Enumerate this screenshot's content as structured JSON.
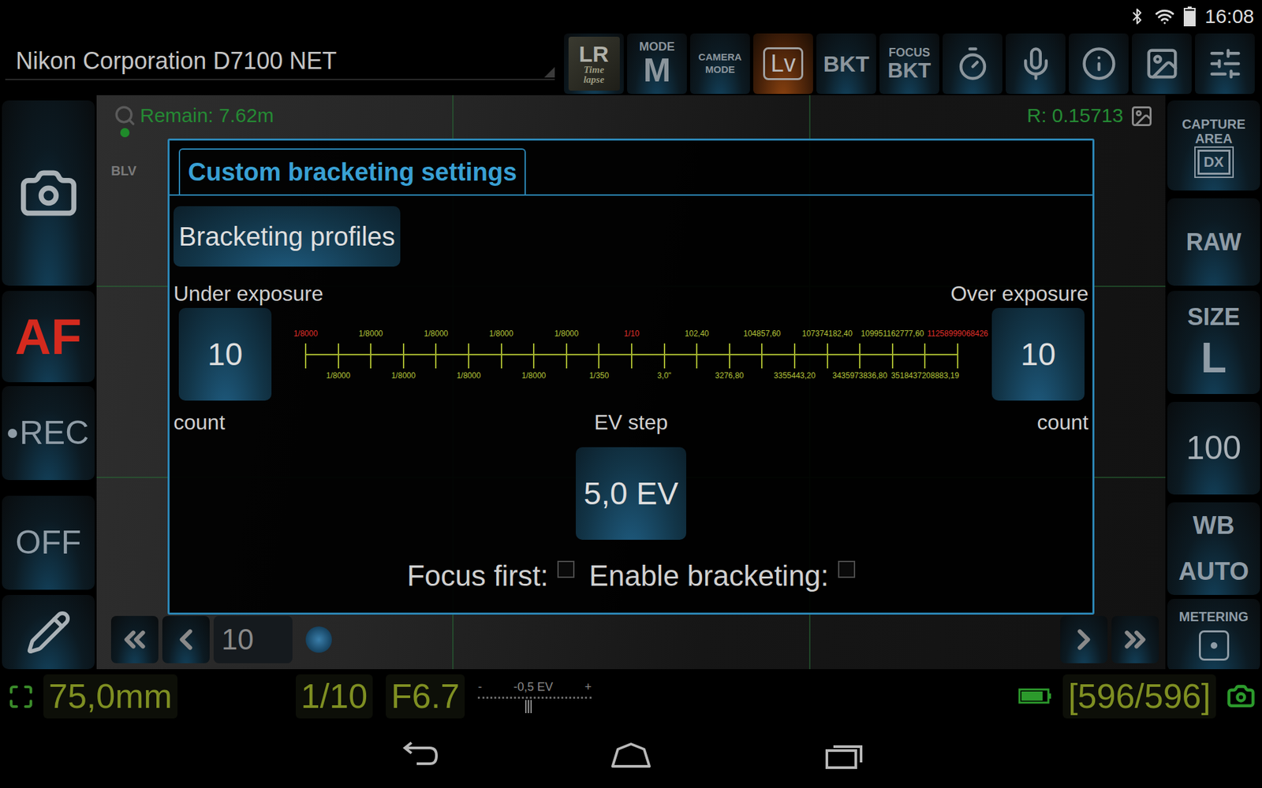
{
  "status_bar": {
    "time": "16:08",
    "battery_level": 0.9
  },
  "app_bar": {
    "title": "Nikon Corporation D7100 NET",
    "toolbar": [
      {
        "kind": "logo",
        "lines": [
          "LR",
          "Time",
          "lapse"
        ],
        "selected": false
      },
      {
        "kind": "stack",
        "small": "MODE",
        "big": "M",
        "selected": false
      },
      {
        "kind": "caption",
        "lines": [
          "CAMERA",
          "MODE"
        ],
        "selected": false
      },
      {
        "kind": "boxed",
        "big": "Lv",
        "selected": true
      },
      {
        "kind": "big",
        "big": "BKT",
        "selected": false
      },
      {
        "kind": "stack",
        "small": "FOCUS",
        "big": "BKT",
        "selected": false
      },
      {
        "kind": "icon",
        "selected": false
      },
      {
        "kind": "icon",
        "selected": false
      },
      {
        "kind": "icon",
        "selected": false
      },
      {
        "kind": "icon",
        "selected": false
      },
      {
        "kind": "icon",
        "selected": false
      }
    ]
  },
  "left_panel": [
    {
      "kind": "icon"
    },
    {
      "kind": "strong",
      "label": "AF",
      "color": "#d42a1e"
    },
    {
      "kind": "rec",
      "label": "REC",
      "color": "#8f9ca6"
    },
    {
      "kind": "text",
      "label": "OFF",
      "color": "#8f9ca6"
    },
    {
      "kind": "icon"
    }
  ],
  "right_panel": [
    {
      "kind": "badge",
      "lines": [
        "CAPTURE",
        "AREA"
      ],
      "badge": "DX"
    },
    {
      "kind": "text",
      "label": "RAW"
    },
    {
      "kind": "stack",
      "small": "SIZE",
      "big": "L"
    },
    {
      "kind": "value",
      "label": "100"
    },
    {
      "kind": "lines",
      "lines": [
        "WB",
        "AUTO"
      ]
    },
    {
      "kind": "caption",
      "lines": [
        "METERING"
      ]
    }
  ],
  "live_view": {
    "remain": "Remain: 7.62m",
    "mode": "BLV",
    "ratio": "R: 0.15713",
    "frame_field": "10"
  },
  "dialog": {
    "tab": "Custom bracketing settings",
    "profiles_button": "Bracketing profiles",
    "under": {
      "label": "Under exposure",
      "count": "10",
      "caption": "count"
    },
    "over": {
      "label": "Over exposure",
      "count": "10",
      "caption": "count"
    },
    "ev_step": {
      "label": "EV step",
      "value": "5,0 EV"
    },
    "scale": {
      "top": [
        {
          "text": "1/8000",
          "color": "#e0302a"
        },
        {
          "text": "1/8000",
          "color": "#b4c43a"
        },
        {
          "text": "1/8000",
          "color": "#b4c43a"
        },
        {
          "text": "1/8000",
          "color": "#b4c43a"
        },
        {
          "text": "1/8000",
          "color": "#b4c43a"
        },
        {
          "text": "1/10",
          "color": "#e0302a"
        },
        {
          "text": "102,40",
          "color": "#b4c43a"
        },
        {
          "text": "104857,60",
          "color": "#b4c43a"
        },
        {
          "text": "107374182,40",
          "color": "#b4c43a"
        },
        {
          "text": "109951162777,60",
          "color": "#b4c43a"
        },
        {
          "text": "11258999068426",
          "color": "#e0302a"
        }
      ],
      "bottom": [
        {
          "text": "1/8000",
          "color": "#b4c43a"
        },
        {
          "text": "1/8000",
          "color": "#b4c43a"
        },
        {
          "text": "1/8000",
          "color": "#b4c43a"
        },
        {
          "text": "1/8000",
          "color": "#b4c43a"
        },
        {
          "text": "1/350",
          "color": "#b4c43a"
        },
        {
          "text": "3,0\"",
          "color": "#b4c43a"
        },
        {
          "text": "3276,80",
          "color": "#b4c43a"
        },
        {
          "text": "3355443,20",
          "color": "#b4c43a"
        },
        {
          "text": "3435973836,80",
          "color": "#b4c43a"
        },
        {
          "text": "3518437208883,19",
          "color": "#b4c43a"
        }
      ]
    },
    "checks": [
      {
        "label": "Focus first:",
        "checked": false
      },
      {
        "label": "Enable bracketing:",
        "checked": false
      }
    ]
  },
  "bottom_bar": {
    "focal": "75,0mm",
    "shutter": "1/10",
    "aperture": "F6.7",
    "meter": {
      "reading": "-0,5 EV",
      "minus": "-",
      "plus": "+",
      "level": 0.45
    },
    "battery_level": 0.85,
    "shots": "[596/596]"
  }
}
